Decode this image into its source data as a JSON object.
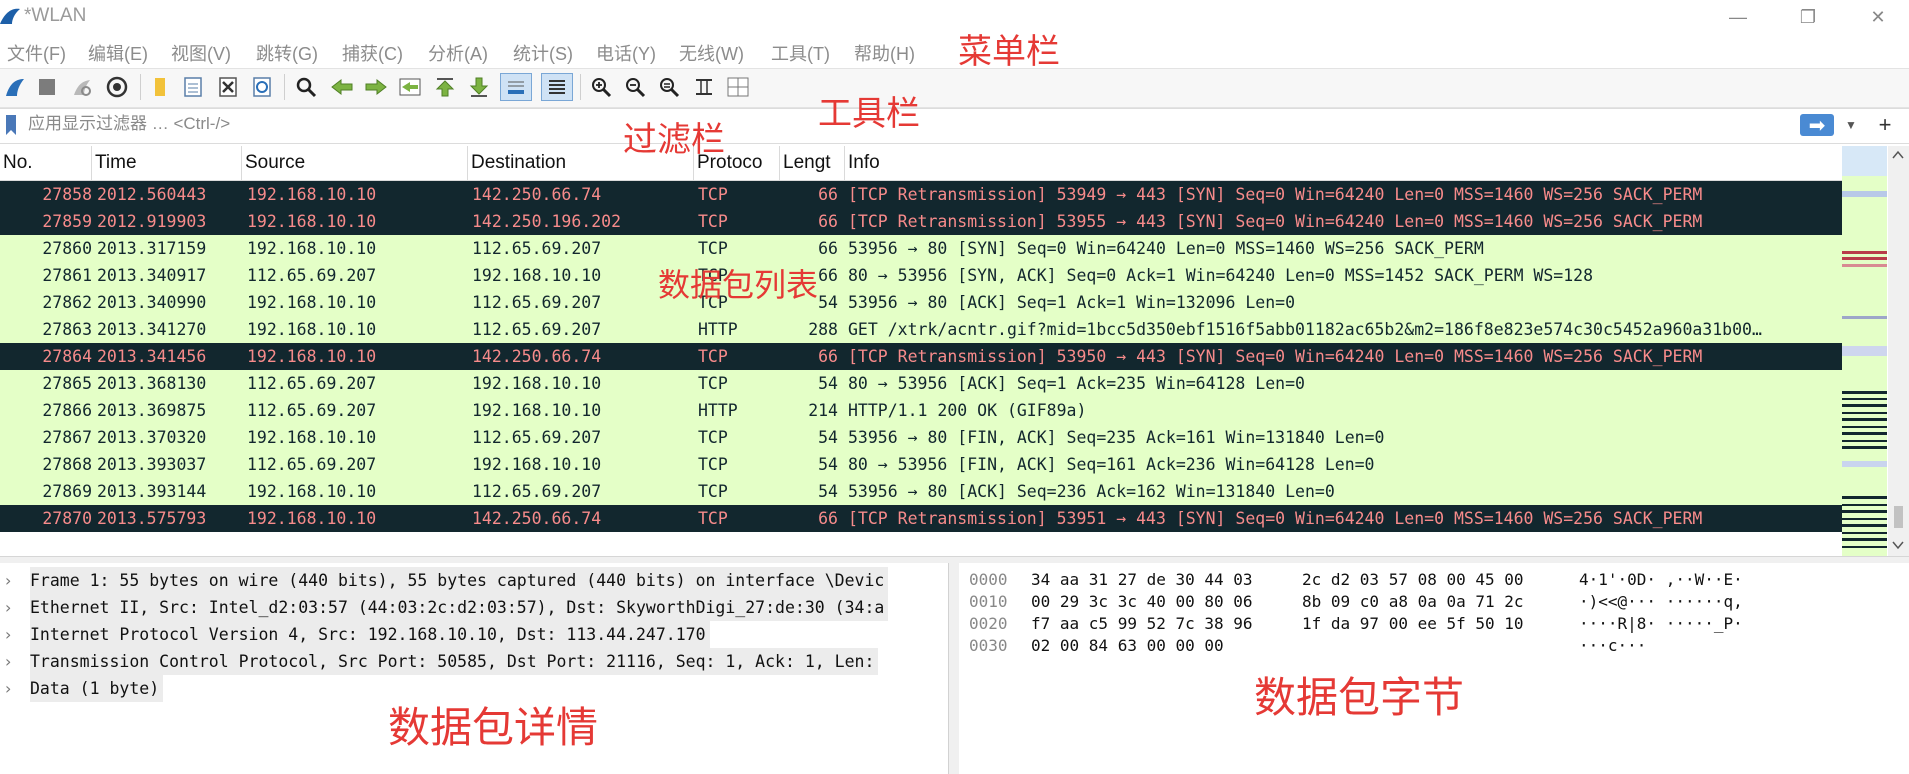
{
  "window": {
    "title": "*WLAN",
    "minimize_glyph": "—",
    "restore_glyph": "❐",
    "close_glyph": "✕"
  },
  "menu": [
    "文件(F)",
    "编辑(E)",
    "视图(V)",
    "跳转(G)",
    "捕获(C)",
    "分析(A)",
    "统计(S)",
    "电话(Y)",
    "无线(W)",
    "工具(T)",
    "帮助(H)"
  ],
  "toolbar_icons": [
    "shark-fin-start-icon",
    "stop-icon",
    "restart-icon",
    "capture-options-gear-icon",
    "open-file-icon",
    "save-file-icon",
    "close-file-icon",
    "reload-file-icon",
    "find-packet-icon",
    "go-back-icon",
    "go-forward-icon",
    "go-to-packet-icon",
    "go-first-icon",
    "go-last-icon",
    "autoscroll-icon",
    "colorize-icon",
    "zoom-in-icon",
    "zoom-out-icon",
    "normal-size-icon",
    "resize-columns-icon",
    "layout-icon"
  ],
  "filter": {
    "placeholder": "应用显示过滤器 … <Ctrl-/>",
    "apply_glyph": "➡",
    "dropdown_glyph": "▼",
    "add_glyph": "+"
  },
  "packet_list": {
    "columns": [
      "No.",
      "Time",
      "Source",
      "Destination",
      "Protoco",
      "Lengt",
      "Info"
    ],
    "rows": [
      {
        "no": "27858",
        "time": "2012.560443",
        "src": "192.168.10.10",
        "dst": "142.250.66.74",
        "proto": "TCP",
        "len": "66",
        "info": "[TCP Retransmission] 53949 → 443 [SYN] Seq=0 Win=64240 Len=0 MSS=1460 WS=256 SACK_PERM",
        "style": "retrans"
      },
      {
        "no": "27859",
        "time": "2012.919903",
        "src": "192.168.10.10",
        "dst": "142.250.196.202",
        "proto": "TCP",
        "len": "66",
        "info": "[TCP Retransmission] 53955 → 443 [SYN] Seq=0 Win=64240 Len=0 MSS=1460 WS=256 SACK_PERM",
        "style": "retrans"
      },
      {
        "no": "27860",
        "time": "2013.317159",
        "src": "192.168.10.10",
        "dst": "112.65.69.207",
        "proto": "TCP",
        "len": "66",
        "info": "53956 → 80 [SYN] Seq=0 Win=64240 Len=0 MSS=1460 WS=256 SACK_PERM",
        "style": "normal"
      },
      {
        "no": "27861",
        "time": "2013.340917",
        "src": "112.65.69.207",
        "dst": "192.168.10.10",
        "proto": "TCP",
        "len": "66",
        "info": "80 → 53956 [SYN, ACK] Seq=0 Ack=1 Win=64240 Len=0 MSS=1452 SACK_PERM WS=128",
        "style": "normal"
      },
      {
        "no": "27862",
        "time": "2013.340990",
        "src": "192.168.10.10",
        "dst": "112.65.69.207",
        "proto": "TCP",
        "len": "54",
        "info": "53956 → 80 [ACK] Seq=1 Ack=1 Win=132096 Len=0",
        "style": "normal"
      },
      {
        "no": "27863",
        "time": "2013.341270",
        "src": "192.168.10.10",
        "dst": "112.65.69.207",
        "proto": "HTTP",
        "len": "288",
        "info": "GET /xtrk/acntr.gif?mid=1bcc5d350ebf1516f5abb01182ac65b2&m2=186f8e823e574c30c5452a960a31b00…",
        "style": "normal"
      },
      {
        "no": "27864",
        "time": "2013.341456",
        "src": "192.168.10.10",
        "dst": "142.250.66.74",
        "proto": "TCP",
        "len": "66",
        "info": "[TCP Retransmission] 53950 → 443 [SYN] Seq=0 Win=64240 Len=0 MSS=1460 WS=256 SACK_PERM",
        "style": "retrans"
      },
      {
        "no": "27865",
        "time": "2013.368130",
        "src": "112.65.69.207",
        "dst": "192.168.10.10",
        "proto": "TCP",
        "len": "54",
        "info": "80 → 53956 [ACK] Seq=1 Ack=235 Win=64128 Len=0",
        "style": "normal"
      },
      {
        "no": "27866",
        "time": "2013.369875",
        "src": "112.65.69.207",
        "dst": "192.168.10.10",
        "proto": "HTTP",
        "len": "214",
        "info": "HTTP/1.1 200 OK  (GIF89a)",
        "style": "normal"
      },
      {
        "no": "27867",
        "time": "2013.370320",
        "src": "192.168.10.10",
        "dst": "112.65.69.207",
        "proto": "TCP",
        "len": "54",
        "info": "53956 → 80 [FIN, ACK] Seq=235 Ack=161 Win=131840 Len=0",
        "style": "normal"
      },
      {
        "no": "27868",
        "time": "2013.393037",
        "src": "112.65.69.207",
        "dst": "192.168.10.10",
        "proto": "TCP",
        "len": "54",
        "info": "80 → 53956 [FIN, ACK] Seq=161 Ack=236 Win=64128 Len=0",
        "style": "normal"
      },
      {
        "no": "27869",
        "time": "2013.393144",
        "src": "192.168.10.10",
        "dst": "112.65.69.207",
        "proto": "TCP",
        "len": "54",
        "info": "53956 → 80 [ACK] Seq=236 Ack=162 Win=131840 Len=0",
        "style": "normal"
      },
      {
        "no": "27870",
        "time": "2013.575793",
        "src": "192.168.10.10",
        "dst": "142.250.66.74",
        "proto": "TCP",
        "len": "66",
        "info": "[TCP Retransmission] 53951 → 443 [SYN] Seq=0 Win=64240 Len=0 MSS=1460 WS=256 SACK_PERM",
        "style": "retrans"
      }
    ]
  },
  "details": [
    "Frame 1: 55 bytes on wire (440 bits), 55 bytes captured (440 bits) on interface \\Devic",
    "Ethernet II, Src: Intel_d2:03:57 (44:03:2c:d2:03:57), Dst: SkyworthDigi_27:de:30 (34:a",
    "Internet Protocol Version 4, Src: 192.168.10.10, Dst: 113.44.247.170",
    "Transmission Control Protocol, Src Port: 50585, Dst Port: 21116, Seq: 1, Ack: 1, Len:",
    "Data (1 byte)"
  ],
  "details_caret": "›",
  "bytes": [
    {
      "offset": "0000",
      "hex1": "34 aa 31 27 de 30 44 03",
      "hex2": "2c d2 03 57 08 00 45 00",
      "ascii": "4·1'·0D· ,··W··E·"
    },
    {
      "offset": "0010",
      "hex1": "00 29 3c 3c 40 00 80 06",
      "hex2": "8b 09 c0 a8 0a 0a 71 2c",
      "ascii": "·)<<@··· ······q,"
    },
    {
      "offset": "0020",
      "hex1": "f7 aa c5 99 52 7c 38 96",
      "hex2": "1f da 97 00 ee 5f 50 10",
      "ascii": "····R|8· ·····_P·"
    },
    {
      "offset": "0030",
      "hex1": "02 00 84 63 00 00 00",
      "hex2": "",
      "ascii": "···c···"
    }
  ],
  "annotations": {
    "menubar": "菜单栏",
    "toolbar": "工具栏",
    "filterbar": "过滤栏",
    "packet_list": "数据包列表",
    "packet_details": "数据包详情",
    "packet_bytes": "数据包字节"
  },
  "colors": {
    "retrans_bg": "#12272e",
    "retrans_fg": "#f78b8b",
    "normal_bg": "#e4ffc7",
    "annotation": "#e53935",
    "filter_apply": "#4a8ad3"
  }
}
